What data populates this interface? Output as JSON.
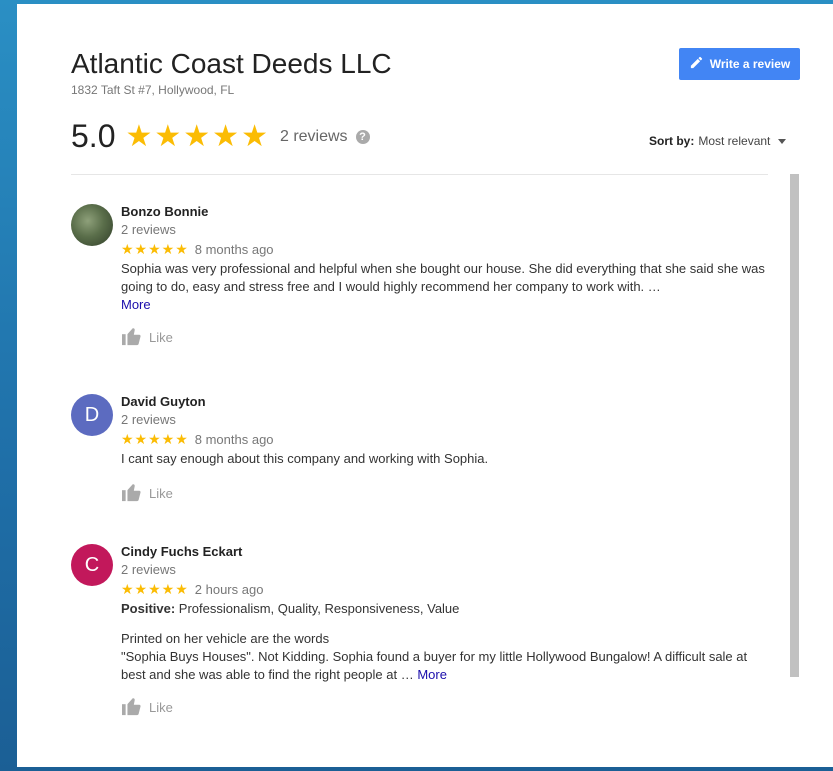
{
  "business": {
    "name": "Atlantic Coast Deeds LLC",
    "address": "1832 Taft St #7, Hollywood, FL",
    "rating": "5.0",
    "stars": "★★★★★",
    "review_count": "2 reviews",
    "help": "?"
  },
  "write_review": {
    "label": "Write a review"
  },
  "sort": {
    "label": "Sort by:",
    "value": "Most relevant"
  },
  "reviews": [
    {
      "name": "Bonzo Bonnie",
      "sub": "2 reviews",
      "stars": "★★★★★",
      "time": "8 months ago",
      "text": "Sophia was very professional and helpful when she bought our house. She did everything that she said she was going to do, easy and stress free and I would highly recommend her company to work with. …",
      "more": "More",
      "like": "Like"
    },
    {
      "initial": "D",
      "name": "David Guyton",
      "sub": "2 reviews",
      "stars": "★★★★★",
      "time": "8 months ago",
      "text": "I cant say enough about this company and working with Sophia.",
      "like": "Like"
    },
    {
      "initial": "C",
      "name": "Cindy Fuchs Eckart",
      "sub": "2 reviews",
      "stars": "★★★★★",
      "time": "2 hours ago",
      "positive_label": "Positive:",
      "positive_value": " Professionalism, Quality, Responsiveness, Value",
      "text_line1": "Printed on her vehicle are the words",
      "text": "\"Sophia Buys Houses\". Not Kidding. Sophia found a buyer for my little Hollywood Bungalow! A difficult sale at best and she was able to find the right people at … ",
      "more": "More",
      "like": "Like"
    }
  ],
  "colors": {
    "accent": "#4285f4",
    "star": "#fbbc04",
    "link": "#1a0dab"
  }
}
